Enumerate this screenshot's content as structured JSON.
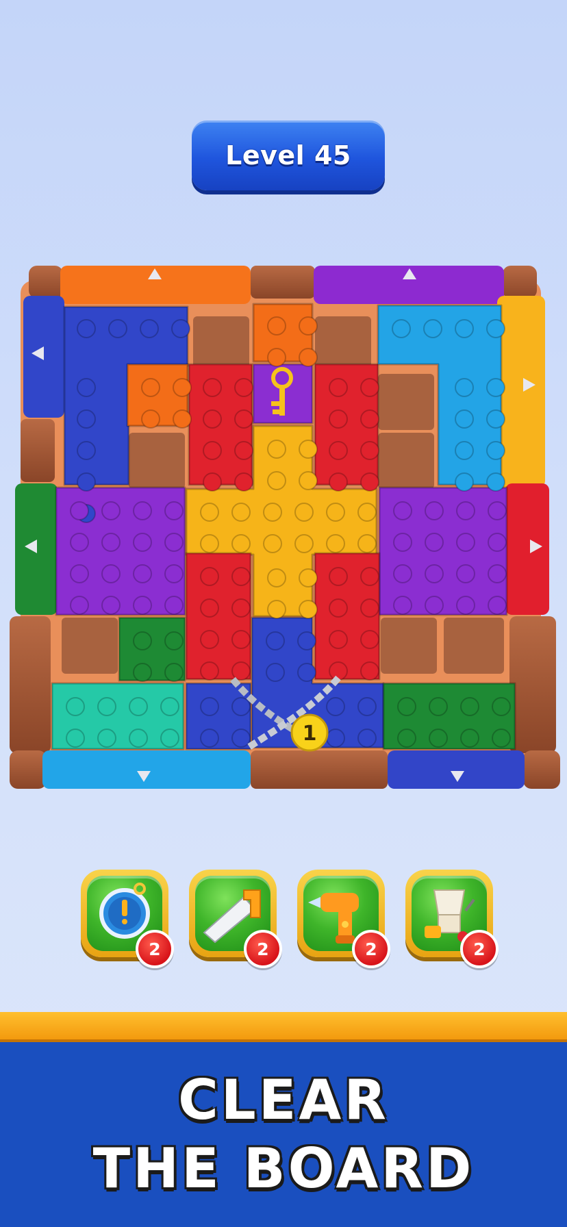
{
  "header": {
    "level_label": "Level 45"
  },
  "board": {
    "colors": {
      "blue": "#3146c9",
      "orange": "#f36d18",
      "purple": "#8b2ed1",
      "red": "#e0222d",
      "yellow": "#f6b419",
      "skyblue": "#23a4e6",
      "green": "#1e8a34",
      "teal": "#25c9a7",
      "brown": "#a45734",
      "gold": "#f9b522"
    },
    "locked_piece": {
      "counter": "1"
    },
    "key_item": "key-icon"
  },
  "boosters": [
    {
      "name": "timer",
      "icon": "stopwatch-icon",
      "count": "2"
    },
    {
      "name": "saw",
      "icon": "saw-icon",
      "count": "2"
    },
    {
      "name": "drill",
      "icon": "drill-icon",
      "count": "2"
    },
    {
      "name": "vacuum",
      "icon": "vacuum-cart-icon",
      "count": "2"
    }
  ],
  "footer": {
    "line1": "CLEAR",
    "line2": "THE BOARD"
  }
}
